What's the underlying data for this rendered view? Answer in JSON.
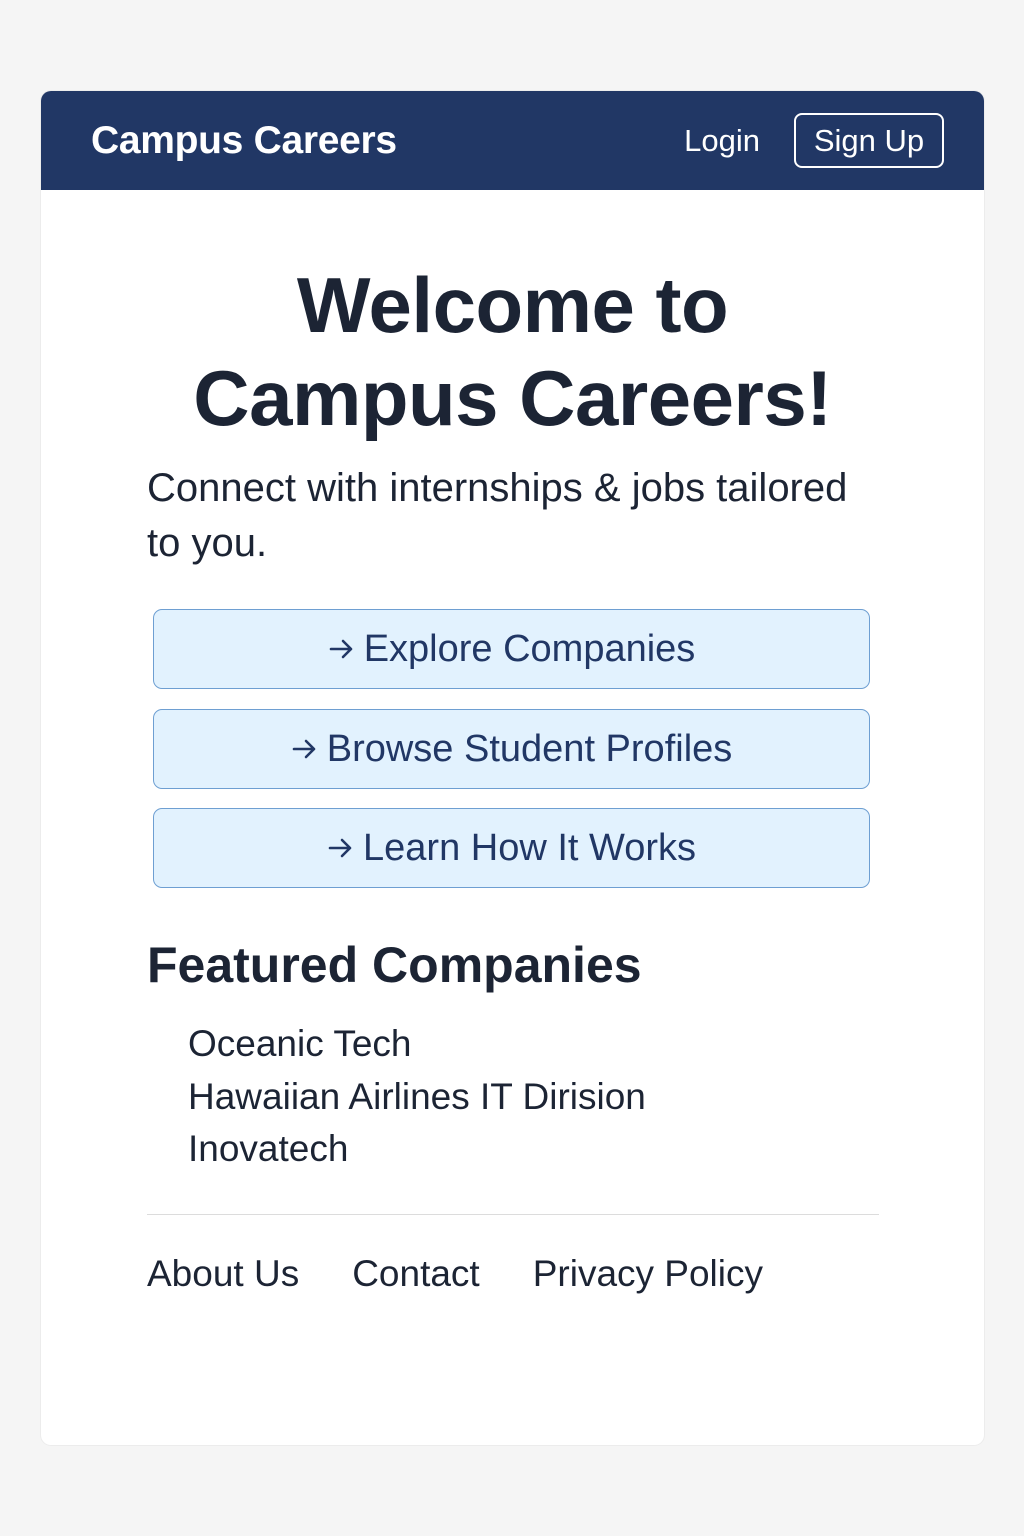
{
  "navbar": {
    "brand": "Campus Careers",
    "login_label": "Login",
    "signup_label": "Sign Up",
    "background_color": "#213765"
  },
  "hero": {
    "title_line1": "Welcome to",
    "title_line2": "Campus Careers!",
    "subtitle": "Connect with internships & jobs tailored to you."
  },
  "actions": [
    {
      "label": "Explore Companies",
      "icon": "arrow-right-icon"
    },
    {
      "label": "Browse Student Profiles",
      "icon": "arrow-right-icon"
    },
    {
      "label": "Learn How It Works",
      "icon": "arrow-right-icon"
    }
  ],
  "featured": {
    "title": "Featured Companies",
    "companies": [
      "Oceanic Tech",
      "Hawaiian Airlines IT Dirision",
      "Inovatech"
    ]
  },
  "footer": {
    "links": [
      "About Us",
      "Contact",
      "Privacy Policy"
    ]
  },
  "colors": {
    "accent_button_bg": "#e2f2fe",
    "accent_button_border": "#6e9fd2",
    "text_dark": "#1c2434"
  }
}
